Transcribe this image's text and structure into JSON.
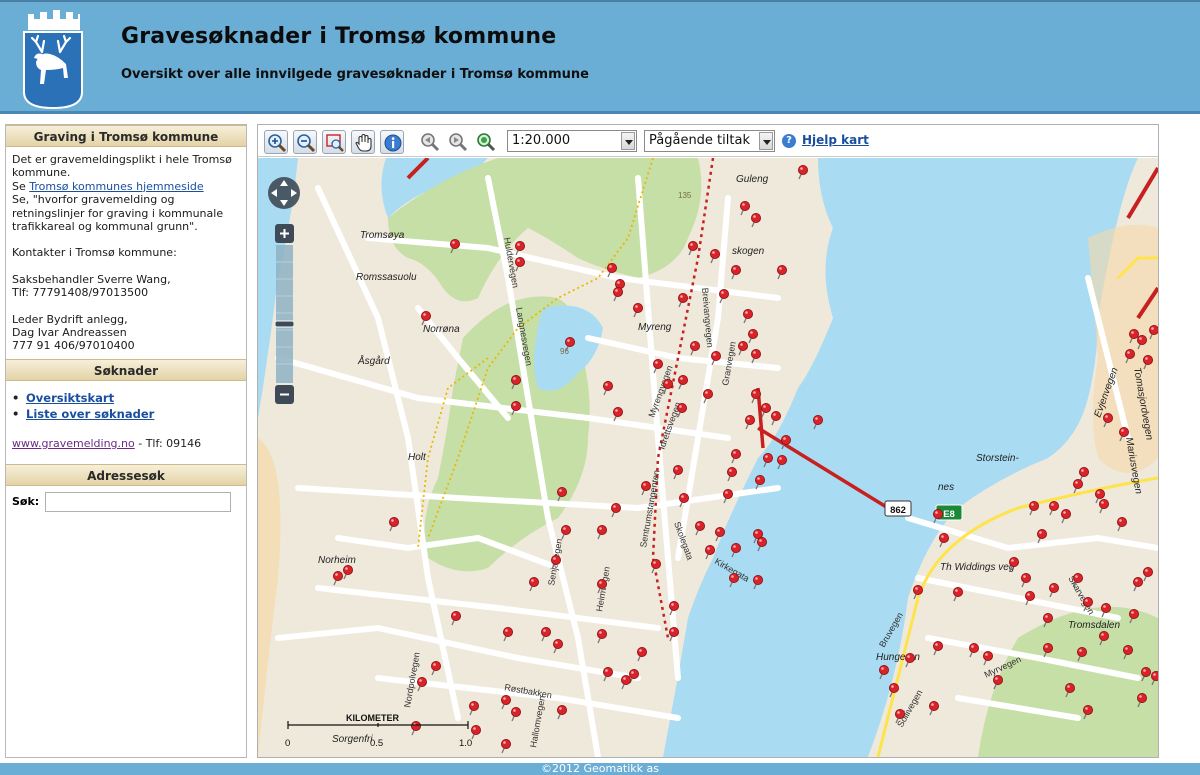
{
  "header": {
    "title": "Gravesøknader i Tromsø kommune",
    "subtitle": "Oversikt over alle innvilgede gravesøknader i Tromsø kommune"
  },
  "sidebar": {
    "info": {
      "heading": "Graving i Tromsø kommune",
      "line1": "Det er gravemeldingsplikt i hele Tromsø kommune.",
      "link_prefix": "Se ",
      "link_text": "Tromsø kommunes hjemmeside",
      "line2": "Se, \"hvorfor gravemelding og retningslinjer for graving i kommunale trafikkareal og kommunal grunn\".",
      "contact_heading": "Kontakter i Tromsø kommune:",
      "contact1_name": "Saksbehandler Sverre Wang,",
      "contact1_phone": "Tlf: 77791408/97013500",
      "contact2_title": "Leder Bydrift anlegg,",
      "contact2_name": "Dag Ivar Andreassen",
      "contact2_phone": "777 91 406/97010400"
    },
    "applications": {
      "heading": "Søknader",
      "links": [
        "Oversiktskart",
        "Liste over søknader"
      ],
      "web_link": "www.gravemelding.no",
      "phone": " - Tlf: 09146"
    },
    "address_search": {
      "heading": "Adressesøk",
      "label": "Søk:",
      "value": "",
      "placeholder": ""
    }
  },
  "toolbar": {
    "tools": [
      "zoom-in-icon",
      "zoom-out-icon",
      "zoom-box-icon",
      "pan-hand-icon",
      "info-icon",
      "zoom-previous-icon",
      "zoom-next-icon",
      "zoom-full-icon"
    ],
    "scale_select": "1:20.000",
    "layer_select": "Pågående tiltak",
    "help_text": "Hjelp kart",
    "help_icon": "?"
  },
  "map": {
    "place_labels": [
      "Guleng",
      "Tromsøya",
      "Romssasuolu",
      "skogen",
      "Norrøna",
      "Myreng",
      "Åsgård",
      "Holt",
      "Norheim",
      "Hungeren",
      "Tromsdalen",
      "Th Widdings veg",
      "Storstein-",
      "nes",
      "Sorgenfri",
      "Evjenvegen",
      "Tomasjordvegen",
      "Mariusvegen"
    ],
    "road_labels": [
      "Huldervegen",
      "Langnesvegen",
      "Breivangvegen",
      "Myrengvegen",
      "Idrettsvegen",
      "Granvegen",
      "Sentrumstangenten",
      "Skolegata",
      "Kirkegata",
      "Senjavegen",
      "Heimvegen",
      "Røstbakken",
      "Nordpolvegen",
      "Hallomvegen",
      "Bruvegen",
      "Myrvegen",
      "Sollivegen",
      "Skarvegen"
    ],
    "route_shields": [
      "862",
      "E8"
    ],
    "elevation_labels": [
      "135",
      "96"
    ],
    "scalebar": {
      "title": "KILOMETER",
      "ticks": [
        "0",
        "0.5",
        "1.0"
      ]
    },
    "colors": {
      "water": "#a9dbf2",
      "land": "#efe9dc",
      "forest": "#c6dfa6",
      "road": "#ffffff",
      "main_road": "#c81f1f",
      "yellow_road": "#ffe34a",
      "pin": "#d8232a"
    }
  },
  "footer": {
    "text": "©2012 Geomatikk as"
  }
}
